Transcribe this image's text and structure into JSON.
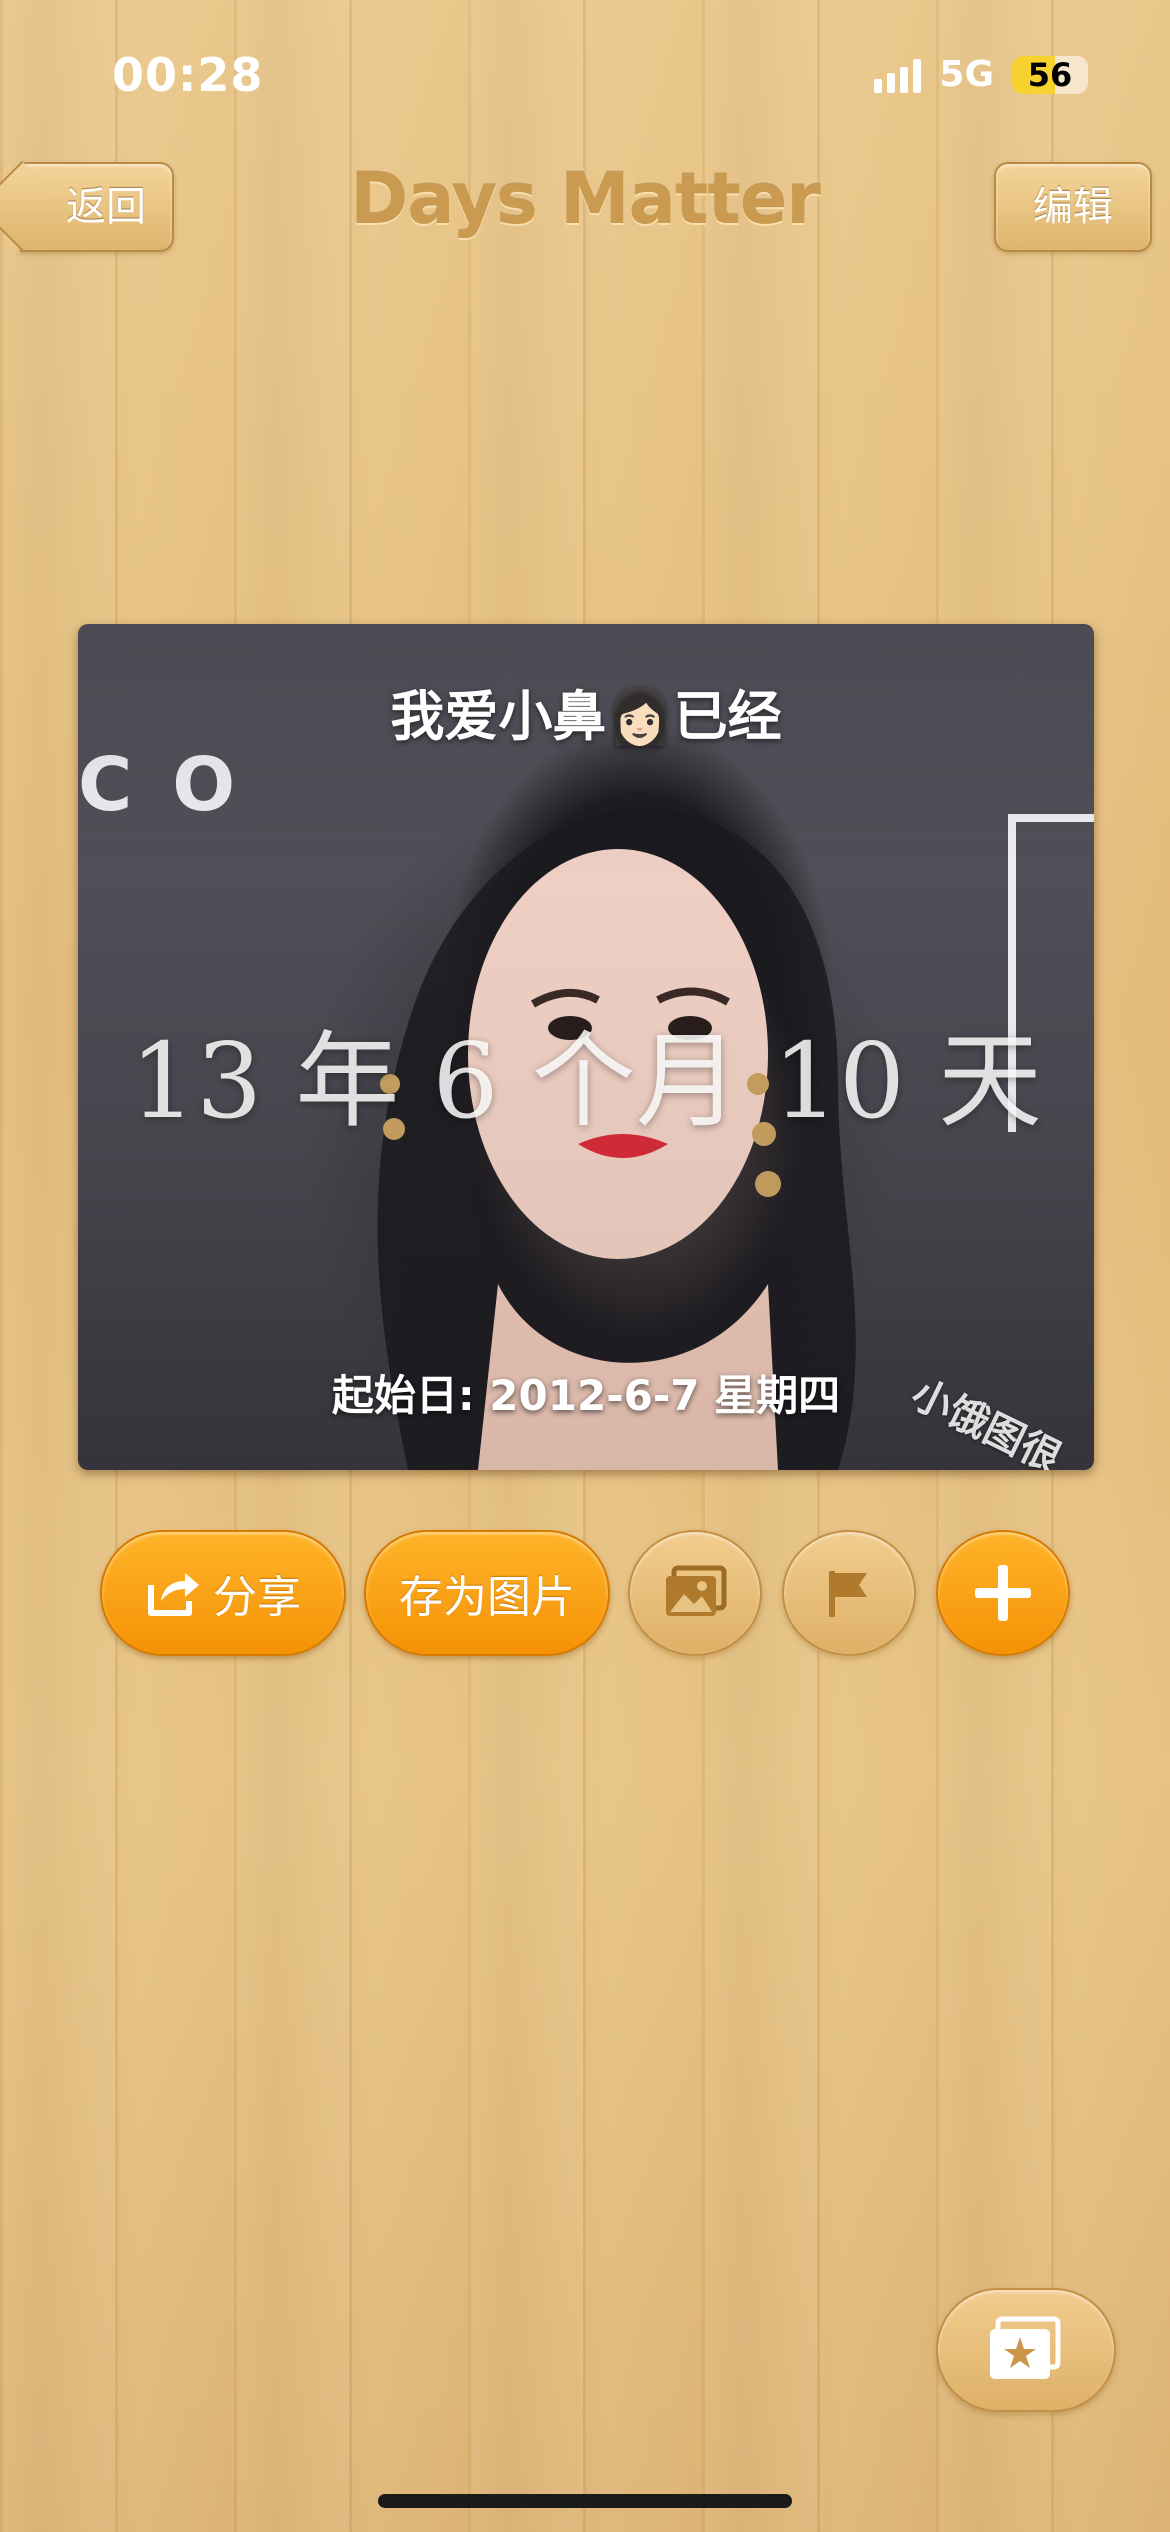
{
  "status": {
    "time": "00:28",
    "network": "5G",
    "battery": "56",
    "battery_level": 0.56
  },
  "nav": {
    "back_label": "返回",
    "title": "Days Matter",
    "edit_label": "编辑"
  },
  "card": {
    "title": "我爱小鼻👩🏻已经",
    "duration": "13 年 6 个月 10 天",
    "start_date": "起始日: 2012-6-7 星期四",
    "background_letters": "CO",
    "watermark": "小饿图很"
  },
  "actions": {
    "share_label": "分享",
    "save_image_label": "存为图片",
    "icons": [
      "share-icon",
      "photo-icon",
      "flag-icon",
      "plus-icon",
      "gallery-star-icon"
    ]
  },
  "colors": {
    "accent_orange": "#f7a10f",
    "wood": "#e6c283",
    "nav_button": "#e8c07e",
    "title_brown": "#c99a4f"
  }
}
